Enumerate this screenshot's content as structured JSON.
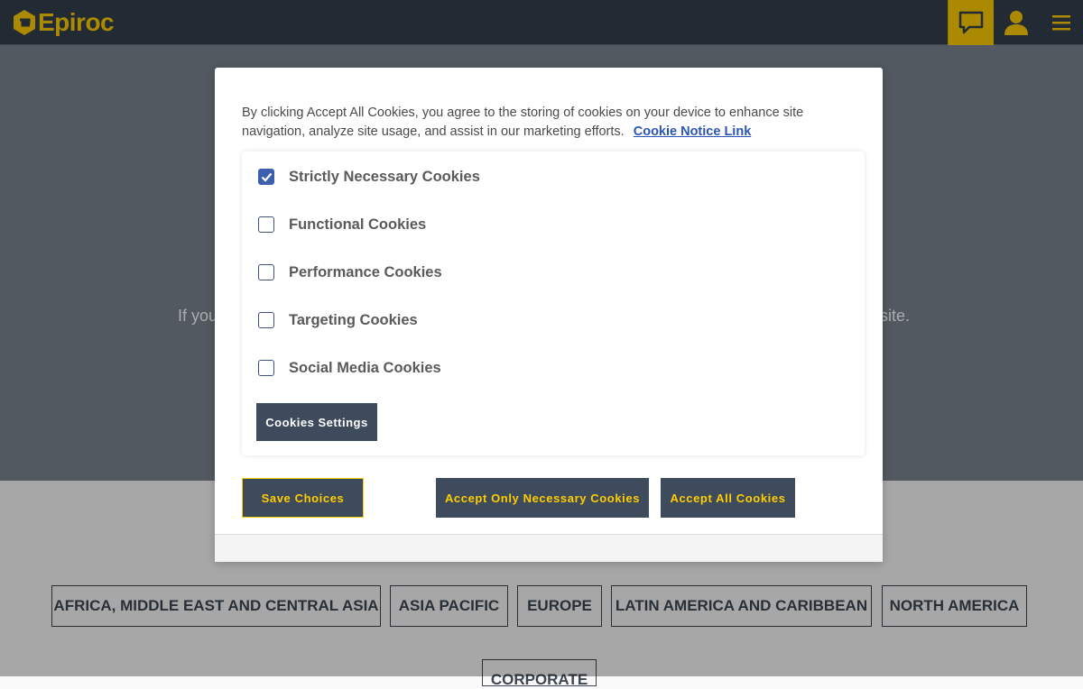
{
  "header": {
    "brand": "Epiroc",
    "chat_icon": "chat-bubble-icon",
    "user_icon": "user-icon",
    "menu_icon": "hamburger-menu-icon",
    "accent": "#ffcd00"
  },
  "hero": {
    "text_left": "If you",
    "text_right": "site."
  },
  "regions": [
    "AFRICA, MIDDLE EAST AND CENTRAL ASIA",
    "ASIA PACIFIC",
    "EUROPE",
    "LATIN AMERICA AND CARIBBEAN",
    "NORTH AMERICA"
  ],
  "corporate": "CORPORATE",
  "cookie_modal": {
    "intro": "By clicking Accept All Cookies, you agree to the storing of cookies on your device to enhance site navigation, analyze site usage, and assist in our marketing efforts.",
    "notice_link": "Cookie Notice Link",
    "categories": [
      {
        "label": "Strictly Necessary Cookies",
        "checked": true
      },
      {
        "label": "Functional Cookies",
        "checked": false
      },
      {
        "label": "Performance Cookies",
        "checked": false
      },
      {
        "label": "Targeting Cookies",
        "checked": false
      },
      {
        "label": "Social Media Cookies",
        "checked": false
      }
    ],
    "settings_button": "Cookies Settings",
    "save_button": "Save Choices",
    "necessary_button": "Accept Only Necessary Cookies",
    "accept_all_button": "Accept All Cookies"
  }
}
